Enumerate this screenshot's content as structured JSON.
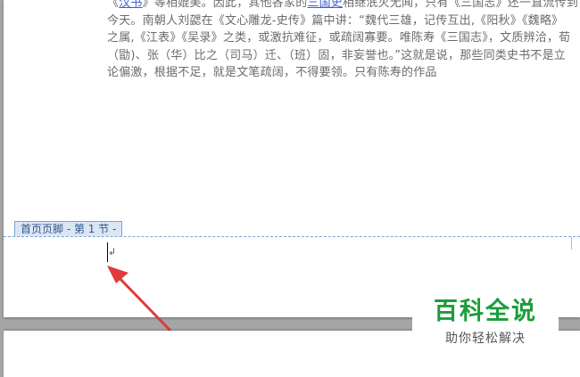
{
  "document": {
    "lines": [
      {
        "pre": "《",
        "link": "汉书",
        "post": "》等相媲美。因此，其他各家的",
        "link2": "三国史",
        "post2": "相继泯灭无闻，只有《三国志》还一直流传到"
      },
      {
        "pre": "今天。南朝人刘勰在《文心雕龙-史传》篇中讲：“魏代三雄，记传互出,《阳秋》《魏略》",
        "link": "",
        "post": "",
        "link2": "",
        "post2": ""
      },
      {
        "pre": "之属,《江表》《吴录》之类，或激抗难征，或疏阔寡要。唯陈寿《三国志》，文质辨洽，荀",
        "link": "",
        "post": "",
        "link2": "",
        "post2": ""
      },
      {
        "pre": "（勖)、张（华）比之（司马）迁、（班）固，非妄誉也。”这就是说，那些同类史书不是立",
        "link": "",
        "post": "",
        "link2": "",
        "post2": ""
      },
      {
        "pre": "论偏激，根据不足，就是文笔疏阔，不得要领。只有陈寿的作品",
        "link": "",
        "post": "",
        "link2": "",
        "post2": ""
      }
    ]
  },
  "footer": {
    "tab_label": "首页页脚 - 第 1 节 -",
    "paragraph_mark": "↲"
  },
  "watermark": {
    "title": "百科全说",
    "subtitle": "助你轻松解决"
  },
  "colors": {
    "link": "#3b5fd9",
    "footer_border": "#7aa3d6",
    "arrow": "#e03a3a",
    "watermark_title": "#1a9d3a"
  },
  "icons": {
    "arrow": "red-arrow-icon",
    "cursor": "text-cursor"
  }
}
